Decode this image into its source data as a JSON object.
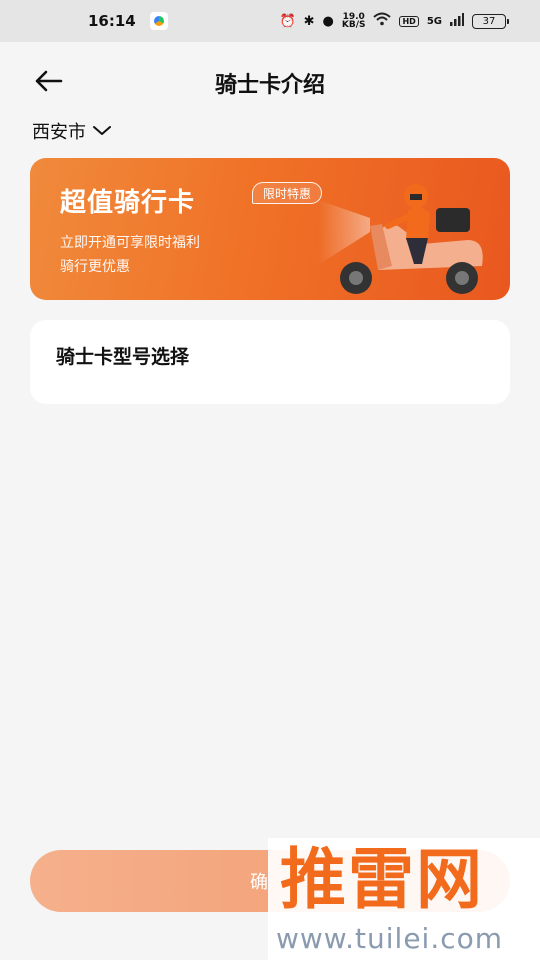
{
  "status_bar": {
    "time": "16:14",
    "speed_value": "19.0",
    "speed_unit": "KB/S",
    "hd": "HD",
    "signal": "5G",
    "battery": "37"
  },
  "header": {
    "title": "骑士卡介绍"
  },
  "city": {
    "name": "西安市"
  },
  "banner": {
    "title": "超值骑行卡",
    "badge": "限时特惠",
    "line1": "立即开通可享限时福利",
    "line2": "骑行更优惠"
  },
  "card_model": {
    "label": "骑士卡型号选择"
  },
  "confirm": {
    "label": "确"
  },
  "watermark": {
    "main": "推雷网",
    "sub": "www.tuilei.com"
  },
  "colors": {
    "accent": "#f07227",
    "confirm_bg": "#f5b08c",
    "page_bg": "#f5f5f5"
  }
}
